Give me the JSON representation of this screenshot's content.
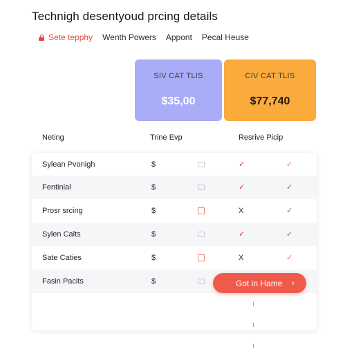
{
  "page": {
    "title": "Technigh desentyoud prcing details"
  },
  "nav": {
    "items": [
      {
        "label": "Sete tepphy",
        "active": true,
        "icon": "lock-icon"
      },
      {
        "label": "Wenth Powers",
        "active": false
      },
      {
        "label": "Appont",
        "active": false
      },
      {
        "label": "Pecal Heuse",
        "active": false
      }
    ]
  },
  "plans": [
    {
      "name": "SIV CAT TLIS",
      "price": "$35,00",
      "color": "#a9acf6"
    },
    {
      "name": "CIV CAT TLIS",
      "price": "$77,740",
      "color": "#fbaa3c"
    }
  ],
  "table": {
    "headers": [
      "Neting",
      "Trine Evp",
      "Resrive Picip"
    ],
    "rows": [
      {
        "label": "Sylean Pvonigh",
        "dollar": "$",
        "box": "grey",
        "a": "✓",
        "a_style": "check-red",
        "b": "✓",
        "b_style": "check-orange"
      },
      {
        "label": "Fentinial",
        "dollar": "$",
        "box": "grey",
        "a": "✓",
        "a_style": "check-red",
        "b": "✓",
        "b_style": "check-grey"
      },
      {
        "label": "Prosr srcing",
        "dollar": "$",
        "box": "red",
        "a": "X",
        "a_style": "x",
        "b": "✓",
        "b_style": "check-grey"
      },
      {
        "label": "Sylen Calts",
        "dollar": "$",
        "box": "grey",
        "a": "✓",
        "a_style": "check-red",
        "b": "✓",
        "b_style": "check-grey"
      },
      {
        "label": "Sate Caties",
        "dollar": "$",
        "box": "red",
        "a": "X",
        "a_style": "x",
        "b": "✓",
        "b_style": "check-orange"
      },
      {
        "label": "Fasin Pacits",
        "dollar": "$",
        "box": "grey",
        "a": "",
        "a_style": "",
        "b": "",
        "b_style": ""
      }
    ]
  },
  "cta": {
    "label": "Got in Hame",
    "arrow": "›",
    "color": "#f05a4a"
  },
  "colors": {
    "accent": "#e8453c",
    "check_red": "#d9312b",
    "check_grey": "#707078"
  }
}
